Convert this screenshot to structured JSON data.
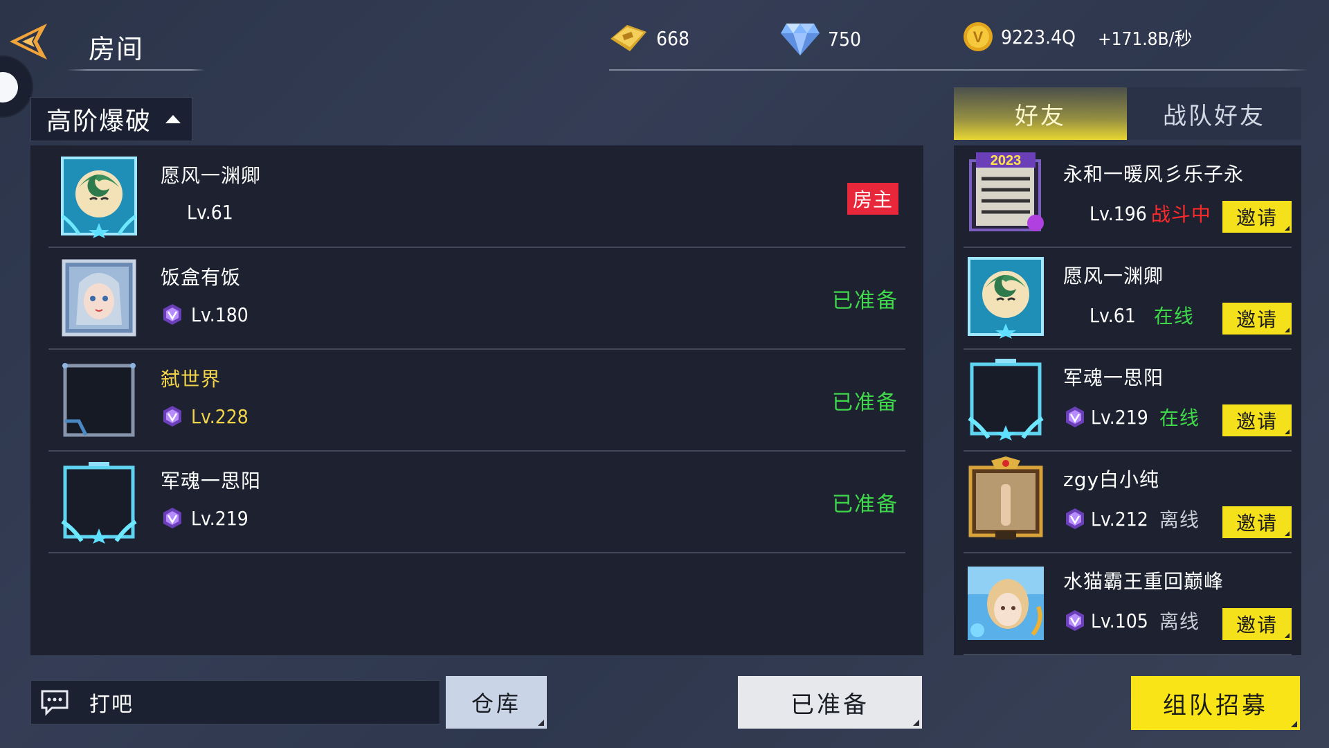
{
  "header": {
    "title": "房间",
    "currencies": [
      {
        "icon": "gold-ticket-icon",
        "value": "668"
      },
      {
        "icon": "diamond-icon",
        "value": "750"
      },
      {
        "icon": "coin-icon",
        "value": "9223.4Q"
      }
    ],
    "rate": "+171.8B/秒"
  },
  "mode_selector": {
    "label": "高阶爆破"
  },
  "room_members": [
    {
      "name": "愿风一渊卿",
      "level": "Lv.61",
      "status": "房主",
      "name_gold": false,
      "rank_icon": false
    },
    {
      "name": "饭盒有饭",
      "level": "Lv.180",
      "status": "已准备",
      "name_gold": false,
      "rank_icon": true
    },
    {
      "name": "弑世界",
      "level": "Lv.228",
      "status": "已准备",
      "name_gold": true,
      "rank_icon": true
    },
    {
      "name": "军魂一思阳",
      "level": "Lv.219",
      "status": "已准备",
      "name_gold": false,
      "rank_icon": true
    }
  ],
  "friends_tabs": {
    "friends": "好友",
    "clan_friends": "战队好友"
  },
  "friends": [
    {
      "name": "永和一暖风彡乐子永",
      "level": "Lv.196",
      "status": "战斗中",
      "invite": "邀请"
    },
    {
      "name": "愿风一渊卿",
      "level": "Lv.61",
      "status": "在线",
      "invite": "邀请"
    },
    {
      "name": "军魂一思阳",
      "level": "Lv.219",
      "status": "在线",
      "invite": "邀请"
    },
    {
      "name": "zgy白小纯",
      "level": "Lv.212",
      "status": "离线",
      "invite": "邀请"
    },
    {
      "name": "水猫霸王重回巅峰",
      "level": "Lv.105",
      "status": "离线",
      "invite": "邀请"
    }
  ],
  "bottom": {
    "chat_text": "打吧",
    "warehouse_label": "仓库",
    "ready_label": "已准备",
    "recruit_label": "组队招募"
  },
  "colors": {
    "accent_yellow": "#f5e01c",
    "online_green": "#3fd84a",
    "battle_red": "#ff2a2a",
    "host_badge": "#e8283a",
    "name_gold": "#f2d44a"
  }
}
